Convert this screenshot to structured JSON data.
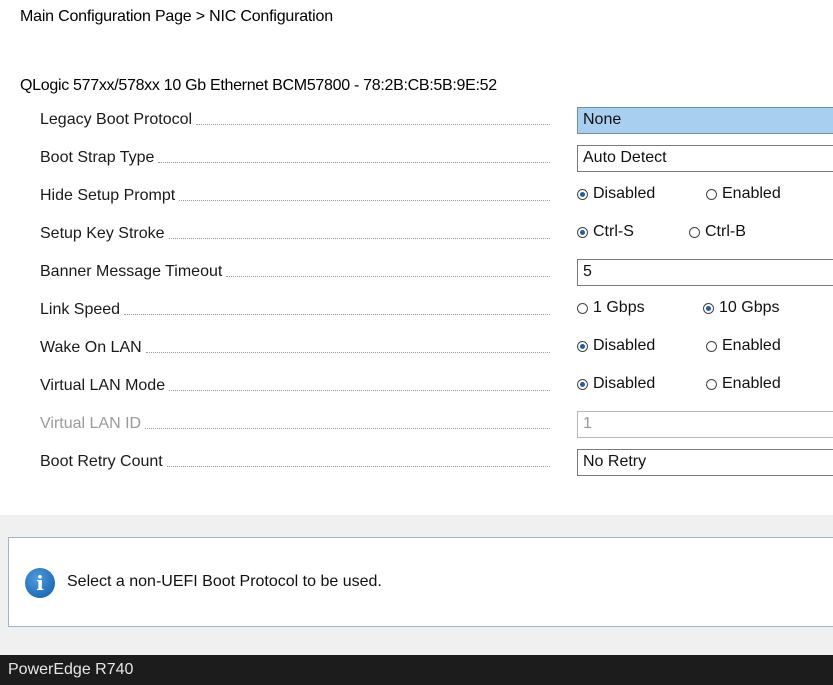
{
  "header": {
    "breadcrumb": "Main Configuration Page > NIC Configuration"
  },
  "section": {
    "title": "QLogic 577xx/578xx 10 Gb Ethernet BCM57800 - 78:2B:CB:5B:9E:52"
  },
  "settings": {
    "legacy_boot_protocol": {
      "label": "Legacy Boot Protocol",
      "value": "None"
    },
    "boot_strap_type": {
      "label": "Boot Strap Type",
      "value": "Auto Detect"
    },
    "hide_setup_prompt": {
      "label": "Hide Setup Prompt",
      "options": [
        "Disabled",
        "Enabled"
      ],
      "selected": "Disabled"
    },
    "setup_key_stroke": {
      "label": "Setup Key Stroke",
      "options": [
        "Ctrl-S",
        "Ctrl-B"
      ],
      "selected": "Ctrl-S"
    },
    "banner_message_timeout": {
      "label": "Banner Message Timeout",
      "value": "5"
    },
    "link_speed": {
      "label": "Link Speed",
      "options": [
        "1 Gbps",
        "10 Gbps"
      ],
      "selected": "10 Gbps"
    },
    "wake_on_lan": {
      "label": "Wake On LAN",
      "options": [
        "Disabled",
        "Enabled"
      ],
      "selected": "Disabled"
    },
    "virtual_lan_mode": {
      "label": "Virtual LAN Mode",
      "options": [
        "Disabled",
        "Enabled"
      ],
      "selected": "Disabled"
    },
    "virtual_lan_id": {
      "label": "Virtual LAN ID",
      "value": "1"
    },
    "boot_retry_count": {
      "label": "Boot Retry Count",
      "value": "No Retry"
    }
  },
  "help": {
    "icon": "info-icon",
    "text": "Select a non-UEFI Boot Protocol to be used."
  },
  "footer": {
    "system_name": "PowerEdge R740"
  },
  "colors": {
    "highlight": "#a9cff0",
    "radio_selected": "#1f5ea8",
    "footer_bg": "#1c1c1c"
  }
}
